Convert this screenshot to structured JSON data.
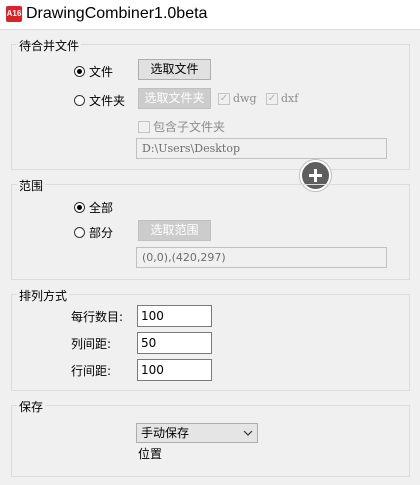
{
  "window": {
    "title": "DrawingCombiner1.0beta",
    "icon": "autocad-a16-icon",
    "icon_text": "A16"
  },
  "merge_files": {
    "group_title": "待合并文件",
    "radio_file_label": "文件",
    "radio_folder_label": "文件夹",
    "select_file_button": "选取文件",
    "select_folder_button": "选取文件夹",
    "dwg_label": "dwg",
    "dxf_label": "dxf",
    "include_subfolders_label": "包含子文件夹",
    "path_value": "D:\\Users\\Desktop"
  },
  "range": {
    "group_title": "范围",
    "radio_all_label": "全部",
    "radio_part_label": "部分",
    "select_range_button": "选取范围",
    "range_value": "(0,0),(420,297)"
  },
  "arrangement": {
    "group_title": "排列方式",
    "per_row_label": "每行数目:",
    "per_row_value": "100",
    "col_spacing_label": "列间距:",
    "col_spacing_value": "50",
    "row_spacing_label": "行间距:",
    "row_spacing_value": "100"
  },
  "save": {
    "group_title": "保存",
    "mode_selected": "手动保存",
    "location_label": "位置"
  },
  "colors": {
    "accent_red": "#d8232a",
    "plus_button": "#5e5e5e"
  }
}
